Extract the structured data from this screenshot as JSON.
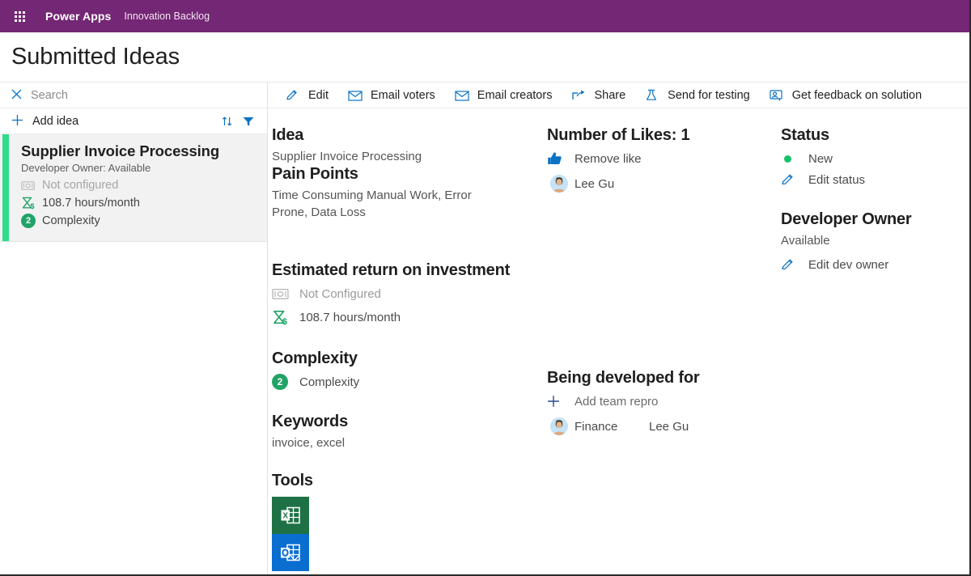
{
  "topbar": {
    "waffle_icon": "app-launcher-icon",
    "brand": "Power Apps",
    "app_name": "Innovation Backlog"
  },
  "page": {
    "title": "Submitted Ideas"
  },
  "left_pane": {
    "search": {
      "clear_icon": "close-icon",
      "placeholder": "Search",
      "value": ""
    },
    "add_idea": {
      "icon": "plus-icon",
      "label": "Add idea",
      "sort_icon": "sort-icon",
      "filter_icon": "filter-icon"
    },
    "cards": [
      {
        "title": "Supplier Invoice Processing",
        "subtitle": "Developer Owner: Available",
        "roi_money": "Not configured",
        "roi_hours": "108.7 hours/month",
        "complexity_value": "2",
        "complexity_label": "Complexity",
        "accent_color": "#2fdc8b",
        "selected": true
      }
    ]
  },
  "command_bar": [
    {
      "label": "Edit",
      "icon": "pencil-icon"
    },
    {
      "label": "Email voters",
      "icon": "envelope-icon"
    },
    {
      "label": "Email creators",
      "icon": "envelope-icon"
    },
    {
      "label": "Share",
      "icon": "share-icon"
    },
    {
      "label": "Send for testing",
      "icon": "beaker-icon"
    },
    {
      "label": "Get feedback on solution",
      "icon": "feedback-person-icon"
    }
  ],
  "detail": {
    "idea": {
      "heading": "Idea",
      "value": "Supplier Invoice Processing"
    },
    "pain_points": {
      "heading": "Pain Points",
      "value": "Time Consuming Manual Work, Error Prone, Data Loss"
    },
    "roi": {
      "heading": "Estimated return on investment",
      "money_icon": "money-icon",
      "money_value": "Not Configured",
      "hours_icon": "hourglass-dollar-icon",
      "hours_value": "108.7 hours/month"
    },
    "complexity": {
      "heading": "Complexity",
      "badge": "2",
      "label": "Complexity"
    },
    "keywords": {
      "heading": "Keywords",
      "value": "invoice, excel"
    },
    "tools": {
      "heading": "Tools",
      "items": [
        {
          "name": "excel-tool-icon",
          "color": "#1e7145"
        },
        {
          "name": "outlook-tool-icon",
          "color": "#0a6ed1"
        }
      ]
    },
    "likes": {
      "heading": "Number of Likes: 1",
      "action_icon": "thumbs-up-icon",
      "action_label": "Remove like",
      "voters": [
        {
          "name": "Lee Gu",
          "avatar": "person-avatar"
        }
      ]
    },
    "developed_for": {
      "heading": "Being developed for",
      "add_icon": "plus-icon",
      "add_label": "Add team repro",
      "rows": [
        {
          "avatar": "person-avatar",
          "team": "Finance",
          "person": "Lee Gu"
        }
      ]
    },
    "status": {
      "heading": "Status",
      "dot_color": "#15c26b",
      "value": "New",
      "edit_icon": "pencil-icon",
      "edit_label": "Edit status"
    },
    "developer_owner": {
      "heading": "Developer Owner",
      "value": "Available",
      "edit_icon": "pencil-icon",
      "edit_label": "Edit dev owner"
    }
  }
}
